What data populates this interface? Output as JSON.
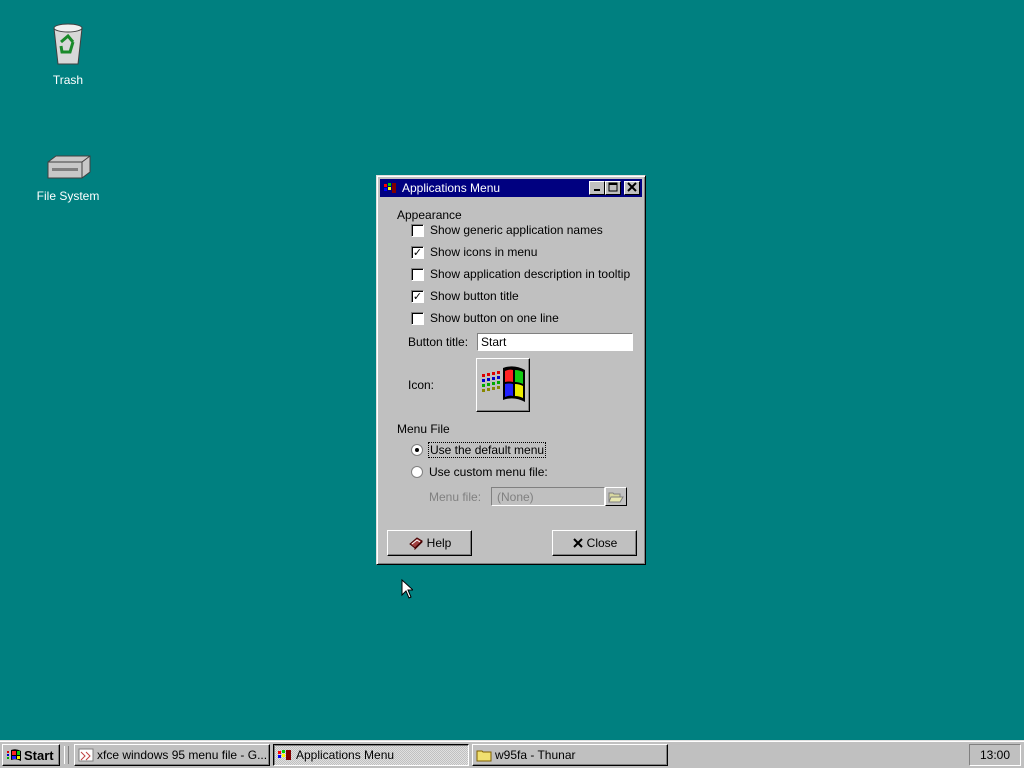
{
  "desktop": {
    "icons": [
      {
        "label": "Trash",
        "icon": "trash-icon"
      },
      {
        "label": "File System",
        "icon": "drive-icon"
      }
    ]
  },
  "window": {
    "title": "Applications Menu",
    "appearance": {
      "heading": "Appearance",
      "options": [
        {
          "label": "Show generic application names",
          "checked": false
        },
        {
          "label": "Show icons in menu",
          "checked": true
        },
        {
          "label": "Show application description in tooltip",
          "checked": false
        },
        {
          "label": "Show button title",
          "checked": true
        },
        {
          "label": "Show button on one line",
          "checked": false
        }
      ],
      "button_title_label": "Button title:",
      "button_title_value": "Start",
      "icon_label": "Icon:"
    },
    "menu_file": {
      "heading": "Menu File",
      "default_label": "Use the default menu",
      "custom_label": "Use custom menu file:",
      "selected": "default",
      "menu_file_label": "Menu file:",
      "menu_file_value": "(None)"
    },
    "help_label": "Help",
    "close_label": "Close"
  },
  "taskbar": {
    "start_label": "Start",
    "tasks": [
      {
        "label": "xfce windows 95 menu file - G...",
        "active": false
      },
      {
        "label": "Applications Menu",
        "active": true
      },
      {
        "label": "w95fa - Thunar",
        "active": false
      }
    ],
    "clock": "13:00"
  },
  "colors": {
    "desktop": "#008080",
    "title_bar": "#000080",
    "face": "#c0c0c0"
  }
}
